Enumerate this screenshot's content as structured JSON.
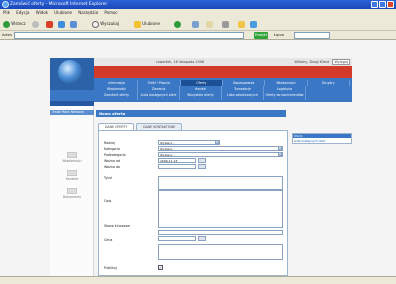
{
  "window": {
    "title": "Zamówić oferty - Microsoft Internet Explorer"
  },
  "menubar": [
    "Plik",
    "Edycja",
    "Widok",
    "Ulubione",
    "Narzędzia",
    "Pomoc"
  ],
  "toolbar": {
    "back": "Wstecz",
    "search": "Wyszukaj",
    "favorites": "Ulubione"
  },
  "addressbar": {
    "label": "Adres",
    "go": "Przejdź",
    "links": "Łącza"
  },
  "site": {
    "header_date": "czwartek, 16 listopada 2006",
    "header_user": "Witamy, Drogi Klient",
    "logout": "Wyloguj"
  },
  "nav": {
    "row1": [
      "Informacje",
      "Treść i Pisanie",
      "Oferty",
      "Dopasowania",
      "Wiadomości",
      "Do góry"
    ],
    "row2": [
      "Wiadomości",
      "Zlecenia",
      "Handel",
      "Transakcje",
      "Logistyka"
    ],
    "row3": [
      "Zamówić oferty",
      "Lista dostępnych ofert",
      "Wszystkie oferty",
      "Lista zakończonych",
      "Oferty do kontrahentów"
    ],
    "active": "Oferty"
  },
  "sidebar": {
    "section_title": "Trade Point Network",
    "items": [
      "Wiadomości",
      "Kontakt",
      "Dokumenty"
    ]
  },
  "main": {
    "title": "Nowa oferta",
    "tabs": [
      "DANE OFERTY",
      "DANE KONTAKTOWE"
    ],
    "fields": {
      "rodzaj": {
        "label": "Rodzaj",
        "value": "Wybierz..."
      },
      "kategoria": {
        "label": "Kategoria",
        "value": "Wybierz..."
      },
      "podkategoria": {
        "label": "Podkategoria",
        "value": "Wybierz..."
      },
      "wazna_od": {
        "label": "Ważna od",
        "value": "2006-11-23"
      },
      "wazna_do": {
        "label": "Ważna do",
        "value": ""
      },
      "tytul": {
        "label": "Tytuł"
      },
      "opis": {
        "label": "Opis"
      },
      "slowa_kluczowe": {
        "label": "Słowa kluczowe"
      },
      "cena": {
        "label": "Cena"
      },
      "publikuj": {
        "label": "Publikuj"
      }
    }
  },
  "rightbox": {
    "title": "Oferty",
    "link": "Lista dostępnych ofert"
  }
}
